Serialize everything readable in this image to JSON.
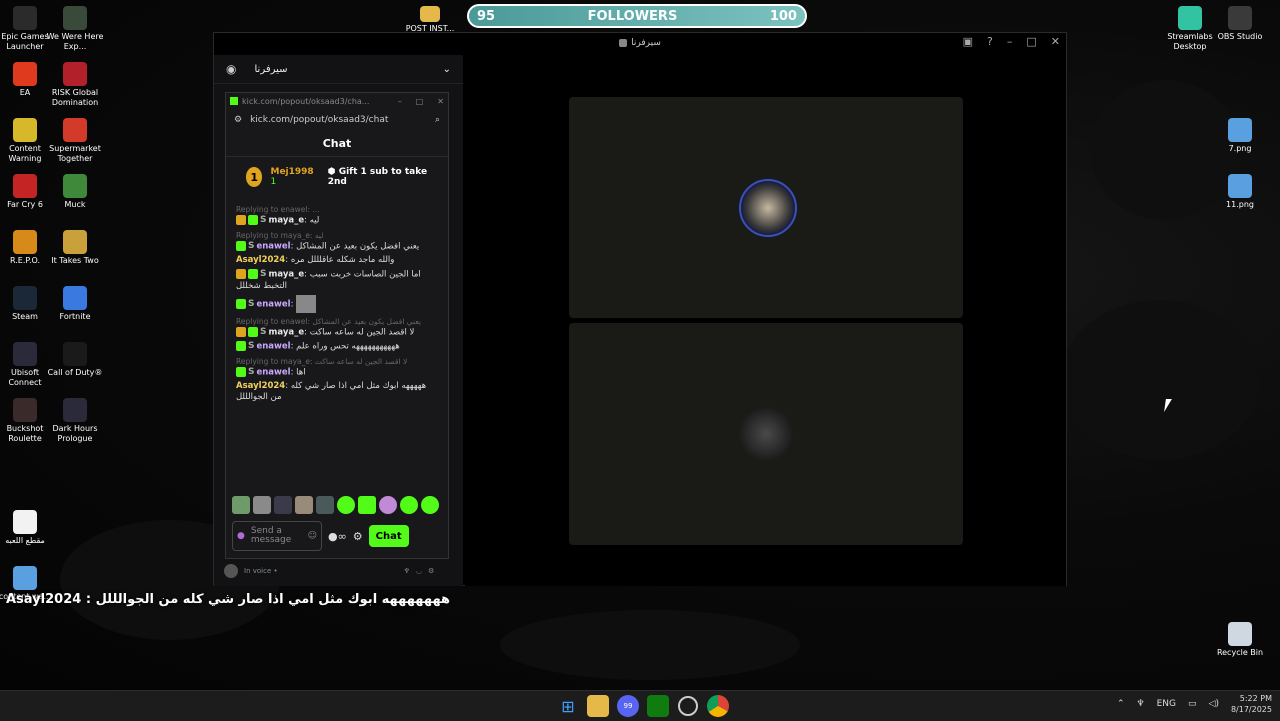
{
  "desktop": {
    "left_icons": [
      {
        "label": "Epic Games Launcher",
        "icon": "epic-icon",
        "color": "#2b2b2b"
      },
      {
        "label": "We Were Here Exp...",
        "icon": "game-icon",
        "color": "#3a4a3a"
      },
      {
        "label": "EA",
        "icon": "ea-icon",
        "color": "#e03a1e"
      },
      {
        "label": "RISK Global Domination",
        "icon": "risk-icon",
        "color": "#b2202a"
      },
      {
        "label": "Content Warning",
        "icon": "content-warning-icon",
        "color": "#d6b82a"
      },
      {
        "label": "Supermarket Together",
        "icon": "supermarket-icon",
        "color": "#d23a2a"
      },
      {
        "label": "Far Cry 6",
        "icon": "farcry-icon",
        "color": "#c42424"
      },
      {
        "label": "Muck",
        "icon": "muck-icon",
        "color": "#3f8a3a"
      },
      {
        "label": "R.E.P.O.",
        "icon": "repo-icon",
        "color": "#d58a1a"
      },
      {
        "label": "It Takes Two",
        "icon": "it-takes-two-icon",
        "color": "#c8a13a"
      },
      {
        "label": "Steam",
        "icon": "steam-icon",
        "color": "#1b2838"
      },
      {
        "label": "Fortnite",
        "icon": "fortnite-icon",
        "color": "#3a7ae0"
      },
      {
        "label": "Ubisoft Connect",
        "icon": "ubisoft-icon",
        "color": "#2a2a3a"
      },
      {
        "label": "Call of Duty®",
        "icon": "cod-icon",
        "color": "#1a1a1a"
      },
      {
        "label": "Buckshot Roulette",
        "icon": "buckshot-icon",
        "color": "#3a2a2a"
      },
      {
        "label": "Dark Hours Prologue",
        "icon": "dark-hours-icon",
        "color": "#2a2a3a"
      },
      {
        "label": "مقطع اللعبه",
        "icon": "file-icon",
        "color": "#f2f2f2"
      },
      {
        "label": "content wa...",
        "icon": "image-file-icon",
        "color": "#5aa0e0"
      }
    ],
    "right_icons": [
      {
        "label": "Streamlabs Desktop",
        "icon": "streamlabs-icon",
        "color": "#31c3a2"
      },
      {
        "label": "OBS Studio",
        "icon": "obs-icon",
        "color": "#3a3a3a"
      },
      {
        "label": "7.png",
        "icon": "png-file-icon",
        "color": "#5aa0e0"
      },
      {
        "label": "11.png",
        "icon": "png-file-icon",
        "color": "#5aa0e0"
      },
      {
        "label": "Recycle Bin",
        "icon": "recycle-bin-icon",
        "color": "#cfd8e0"
      }
    ],
    "top_folder_label": "POST INST..."
  },
  "followers_bar": {
    "start": "95",
    "label": "FOLLOWERS",
    "end": "100",
    "progress": 0.0
  },
  "discord": {
    "window_title": "سيرفرنا",
    "server_name": "سيرفرنا",
    "in_voice": "In voice •"
  },
  "kick": {
    "window_url_title": "kick.com/popout/oksaad3/cha...",
    "url": "kick.com/popout/oksaad3/chat",
    "title": "Chat",
    "top_user": "Mej1998",
    "top_count": "1",
    "rank": "1",
    "gift_text": "Gift 1 sub to take 2nd",
    "input_placeholder": "Send a message",
    "chat_button": "Chat",
    "messages": [
      {
        "reply": "Replying to enawel: ...",
        "badges": [
          "crown",
          "sub",
          "s"
        ],
        "user": "maya_e",
        "user_color": "#e8e8e8",
        "text": "ليه"
      },
      {
        "reply": "Replying to maya_e: ليه",
        "badges": [
          "sub",
          "s"
        ],
        "user": "enawel",
        "user_color": "#c9a9ff",
        "text": "يعني افضل يكون بعيد عن المشاكل"
      },
      {
        "reply": "",
        "badges": [],
        "user": "Asayl2024",
        "user_color": "#f2d15c",
        "text": "والله ماجد شكله عاقلللل مره"
      },
      {
        "reply": "",
        "badges": [
          "crown",
          "sub",
          "s"
        ],
        "user": "maya_e",
        "user_color": "#e8e8e8",
        "text": "اما الجين الصاسات خربت سبب التخبط شخللل"
      },
      {
        "reply": "",
        "badges": [
          "sub",
          "s"
        ],
        "user": "enawel",
        "user_color": "#c9a9ff",
        "text": ""
      },
      {
        "reply": "Replying to enawel: يعني افضل يكون بعيد عن المشاكل",
        "badges": [
          "crown",
          "sub",
          "s"
        ],
        "user": "maya_e",
        "user_color": "#e8e8e8",
        "text": "لا اقصد الجين له ساعه ساكت"
      },
      {
        "reply": "",
        "badges": [
          "sub",
          "s"
        ],
        "user": "enawel",
        "user_color": "#c9a9ff",
        "text": "هههههههههههه تحس وراه علم"
      },
      {
        "reply": "Replying to maya_e: لا اقصد الجين له ساعه ساكت",
        "badges": [
          "sub",
          "s"
        ],
        "user": "enawel",
        "user_color": "#c9a9ff",
        "text": "اها"
      },
      {
        "reply": "",
        "badges": [],
        "user": "Asayl2024",
        "user_color": "#f2d15c",
        "text": "هههههه ابوك مثل امي اذا صار شي كله من الجوالللل"
      }
    ]
  },
  "overlay": {
    "user": "Asayl2024",
    "separator": " : ",
    "text": "هههههههه ابوك مثل امي اذا صار شي كله من الجوالللل"
  },
  "taskbar": {
    "lang": "ENG",
    "time": "5:22 PM",
    "date": "8/17/2025",
    "discord_badge": "99"
  }
}
